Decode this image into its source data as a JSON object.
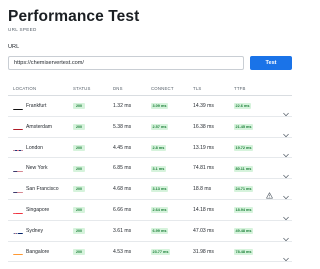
{
  "header": {
    "title": "Performance Test",
    "subtitle": "URL SPEED"
  },
  "form": {
    "url_label": "URL",
    "url_value": "https://chemiservertest.com/",
    "test_label": "Test"
  },
  "table": {
    "columns": [
      "LOCATION",
      "STATUS",
      "DNS",
      "CONNECT",
      "TLS",
      "TTFB"
    ],
    "rows": [
      {
        "flag": "de",
        "location": "Frankfurt",
        "status": "200",
        "dns": "1.32 ms",
        "connect": "3.09 ms",
        "tls": "14.39 ms",
        "ttfb": "22.6 ms",
        "warning": false
      },
      {
        "flag": "nl",
        "location": "Amsterdam",
        "status": "200",
        "dns": "5.38 ms",
        "connect": "2.57 ms",
        "tls": "16.38 ms",
        "ttfb": "21.45 ms",
        "warning": false
      },
      {
        "flag": "gb",
        "location": "London",
        "status": "200",
        "dns": "4.45 ms",
        "connect": "2.8 ms",
        "tls": "13.19 ms",
        "ttfb": "19.72 ms",
        "warning": false
      },
      {
        "flag": "us",
        "location": "New York",
        "status": "200",
        "dns": "6.85 ms",
        "connect": "3.1 ms",
        "tls": "74.81 ms",
        "ttfb": "80.11 ms",
        "warning": false
      },
      {
        "flag": "us",
        "location": "San Francisco",
        "status": "200",
        "dns": "4.68 ms",
        "connect": "3.13 ms",
        "tls": "18.8 ms",
        "ttfb": "24.71 ms",
        "warning": true
      },
      {
        "flag": "sg",
        "location": "Singapore",
        "status": "200",
        "dns": "6.66 ms",
        "connect": "2.64 ms",
        "tls": "14.18 ms",
        "ttfb": "18.94 ms",
        "warning": false
      },
      {
        "flag": "au",
        "location": "Sydney",
        "status": "200",
        "dns": "3.61 ms",
        "connect": "6.99 ms",
        "tls": "47.03 ms",
        "ttfb": "49.48 ms",
        "warning": false
      },
      {
        "flag": "in",
        "location": "Bangalore",
        "status": "200",
        "dns": "4.53 ms",
        "connect": "23.77 ms",
        "tls": "31.98 ms",
        "ttfb": "78.48 ms",
        "warning": false
      }
    ]
  },
  "icons": {
    "warning": "warning-triangle-icon",
    "expand": "chevron-down-icon"
  },
  "colors": {
    "accent": "#1a73e8",
    "good_badge_bg": "#d6f3dc",
    "good_badge_text": "#1a7f37"
  }
}
